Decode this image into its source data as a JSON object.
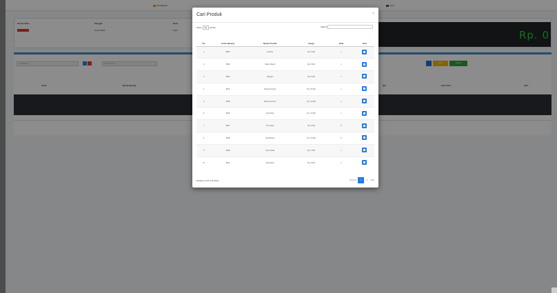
{
  "topnav": {
    "items": [
      "Pendapatan",
      "Kasir"
    ]
  },
  "info": {
    "cols": [
      {
        "label": "Nomor Nota",
        "value": "INV0001"
      },
      {
        "label": "Tanggal",
        "value": "01-01-2024"
      },
      {
        "label": "Kasir",
        "value": "Kasir"
      }
    ],
    "total": "Rp. 0"
  },
  "toolbar": {
    "search_placeholder": "Kode Barang",
    "product_placeholder": "Nama Barang",
    "yellow_label": "Batal",
    "green_label": "Simpan"
  },
  "main_table": {
    "headers": [
      "Kode",
      "Nama Barang",
      "Qty",
      "Sub Total",
      "Aksi"
    ]
  },
  "modal": {
    "title": "Cari Produk",
    "close": "×",
    "show_label": "Show",
    "entries_value": "10",
    "entries_label": "entries",
    "search_label": "Search:",
    "columns": [
      "No",
      "Kode Barang",
      "Nama Produk",
      "Harga",
      "Stok",
      "Aksi"
    ],
    "rows": [
      {
        "no": "1",
        "kode": "B001",
        "nama": "Indomie",
        "harga": "Rp. 3.000",
        "stok": "1"
      },
      {
        "no": "2",
        "kode": "B002",
        "nama": "Sabun Mandi",
        "harga": "Rp. 5.000",
        "stok": "1"
      },
      {
        "no": "3",
        "kode": "B003",
        "nama": "Shampo",
        "harga": "Rp. 8.000",
        "stok": "1"
      },
      {
        "no": "4",
        "kode": "B004",
        "nama": "Minyak Goreng",
        "harga": "Rp. 15.000",
        "stok": "1"
      },
      {
        "no": "5",
        "kode": "B005",
        "nama": "Beras Premium",
        "harga": "Rp. 12.000",
        "stok": "1"
      },
      {
        "no": "6",
        "kode": "B006",
        "nama": "Gula Pasir",
        "harga": "Rp. 14.000",
        "stok": "1"
      },
      {
        "no": "7",
        "kode": "B007",
        "nama": "Teh Celup",
        "harga": "Rp. 6.000",
        "stok": "8"
      },
      {
        "no": "8",
        "kode": "B008",
        "nama": "Kopi Bubuk",
        "harga": "Rp. 10.000",
        "stok": "8"
      },
      {
        "no": "9",
        "kode": "B009",
        "nama": "Susu Kotak",
        "harga": "Rp. 7.000",
        "stok": "1"
      },
      {
        "no": "10",
        "kode": "B010",
        "nama": "Roti Tawar",
        "harga": "Rp. 9.000",
        "stok": "1"
      }
    ],
    "info": "Showing 1 to 10 of 12 entries",
    "prev": "Previous",
    "page1": "1",
    "page2": "2",
    "next": "Next"
  }
}
